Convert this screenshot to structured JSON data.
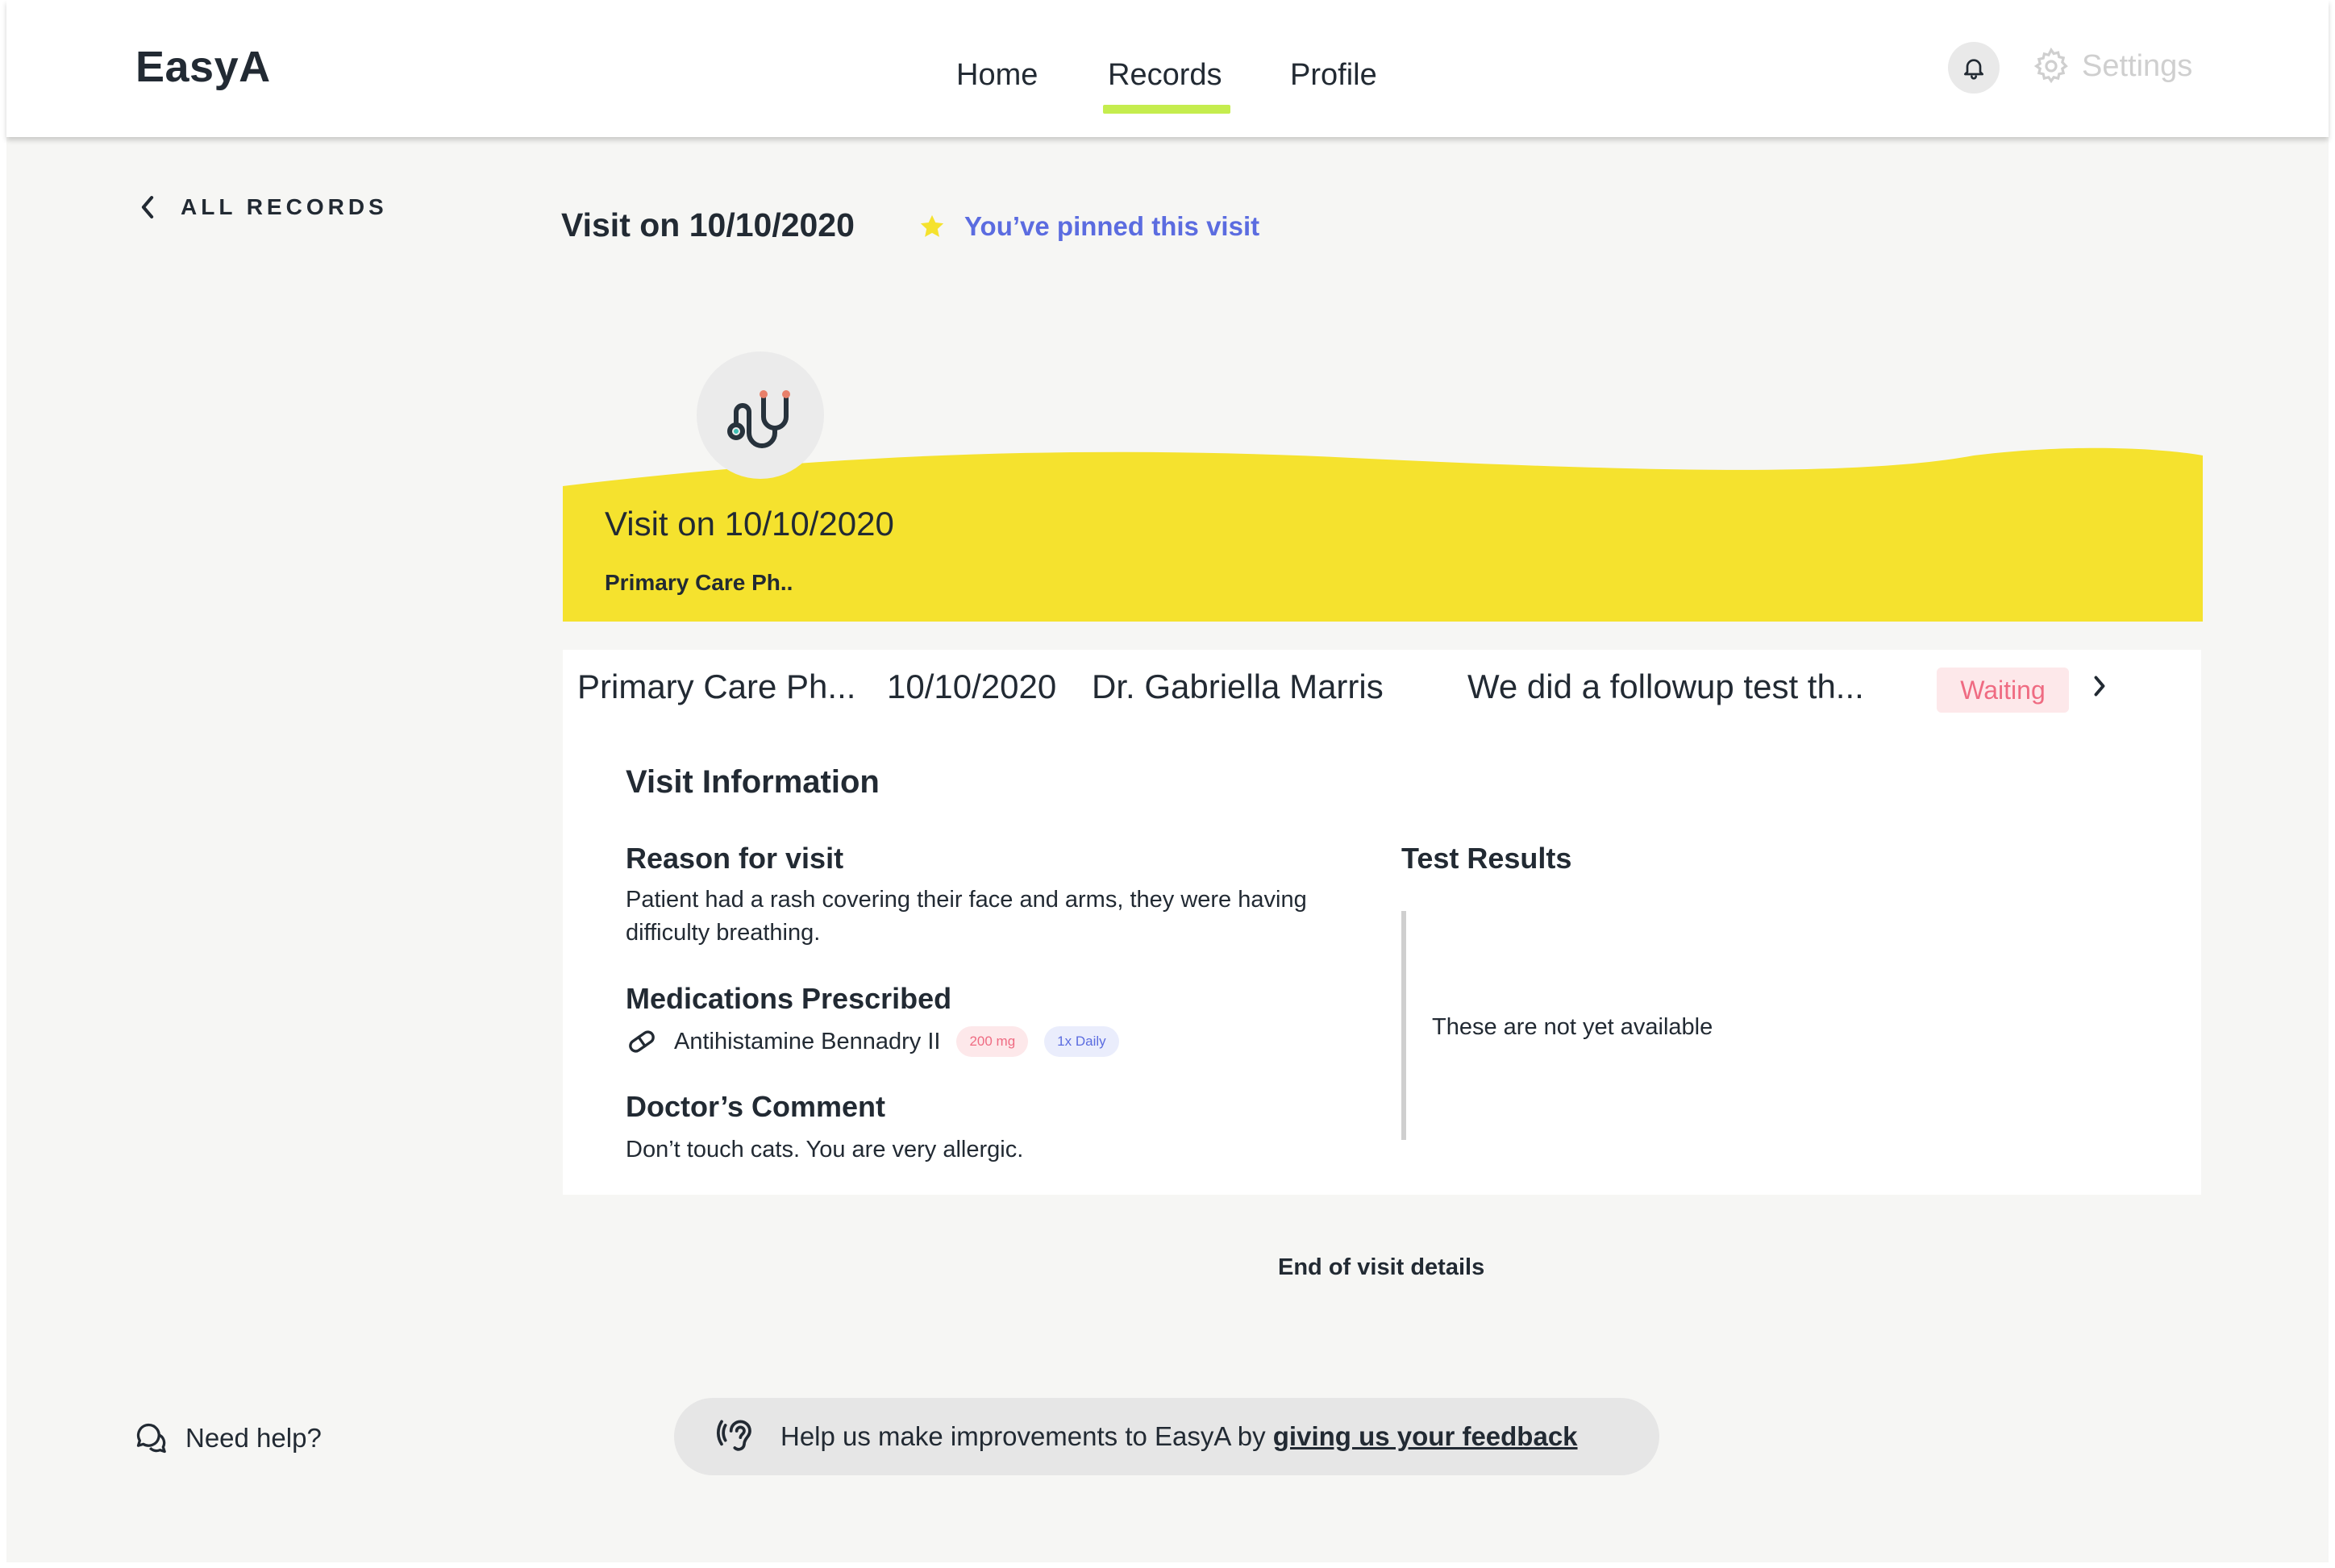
{
  "app": {
    "logo": "EasyA"
  },
  "nav": {
    "home": "Home",
    "records": "Records",
    "profile": "Profile",
    "active": "Records"
  },
  "header": {
    "settings_label": "Settings"
  },
  "back": {
    "label": "ALL RECORDS"
  },
  "page": {
    "title": "Visit on 10/10/2020",
    "pinned_text": "You’ve pinned this visit"
  },
  "banner": {
    "title": "Visit on 10/10/2020",
    "subtitle": "Primary Care Ph..",
    "color": "#f5e22e"
  },
  "visit_row": {
    "type": "Primary Care Ph...",
    "date": "10/10/2020",
    "doctor": "Dr. Gabriella Marris",
    "summary": "We did a followup test th...",
    "status": "Waiting"
  },
  "visit_info": {
    "heading": "Visit Information",
    "reason_heading": "Reason for visit",
    "reason_text": "Patient had a rash covering their face and arms, they were having difficulty breathing.",
    "meds_heading": "Medications Prescribed",
    "medication": {
      "name": "Antihistamine Bennadry II",
      "dose": "200 mg",
      "frequency": "1x Daily"
    },
    "comment_heading": "Doctor’s Comment",
    "comment_text": "Don’t touch cats. You are very allergic.",
    "tests_heading": "Test Results",
    "tests_text": "These are not yet available"
  },
  "end_text": "End of visit details",
  "footer": {
    "help_label": "Need help?",
    "feedback_prefix": "Help us make improvements to EasyA by ",
    "feedback_link": "giving us your feedback"
  },
  "icons": [
    "bell-icon",
    "gear-icon",
    "chevron-left-icon",
    "star-icon",
    "stethoscope-icon",
    "chevron-right-icon",
    "pill-icon",
    "chat-bubbles-icon",
    "ear-icon"
  ],
  "colors": {
    "accent_underline": "#c5ed4e",
    "pinned_blue": "#5b6ce0",
    "waiting_red": "#ef6b82",
    "star_yellow": "#f5e22e"
  }
}
